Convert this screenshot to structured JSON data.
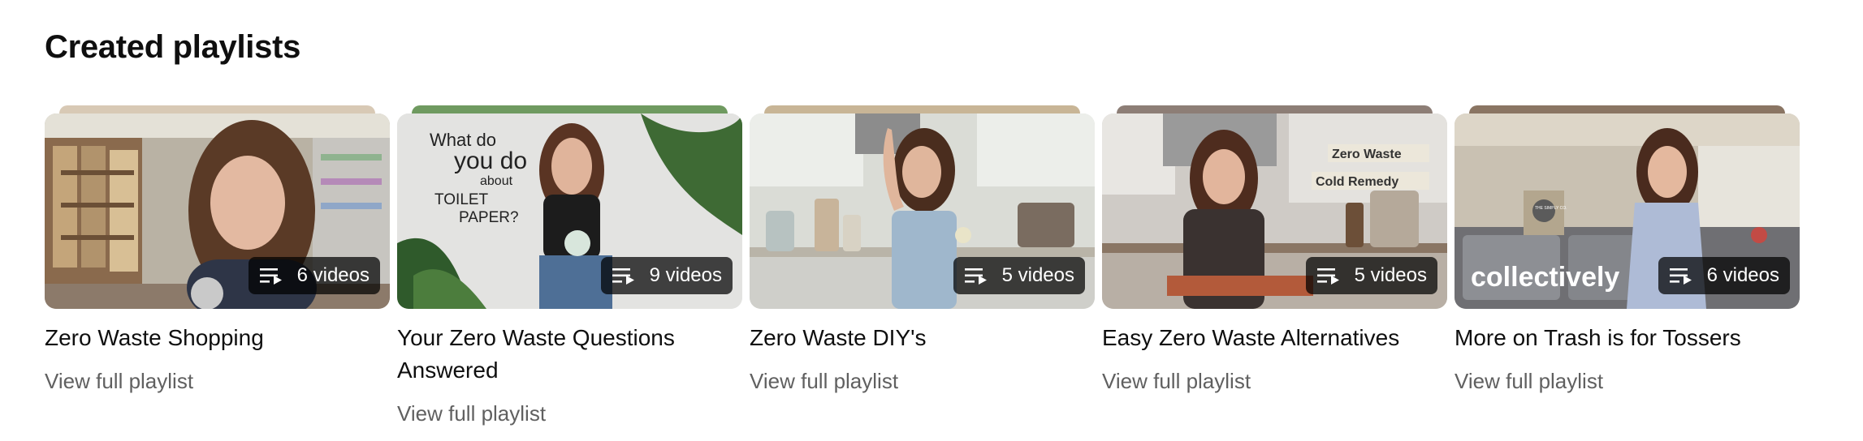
{
  "section": {
    "title": "Created playlists"
  },
  "playlists": [
    {
      "title": "Zero Waste Shopping",
      "count": "6 videos",
      "link": "View full playlist",
      "stack_color": "#d8c9b5"
    },
    {
      "title": "Your Zero Waste Questions Answered",
      "count": "9 videos",
      "link": "View full playlist",
      "stack_color": "#6f9a60",
      "thumb_text": [
        "What do",
        "you do",
        "about",
        "TOILET",
        "PAPER?"
      ]
    },
    {
      "title": "Zero Waste DIY's",
      "count": "5 videos",
      "link": "View full playlist",
      "stack_color": "#c8b596"
    },
    {
      "title": "Easy Zero Waste Alternatives",
      "count": "5 videos",
      "link": "View full playlist",
      "stack_color": "#8d7e76",
      "thumb_text": [
        "Zero Waste",
        "Cold Remedy"
      ]
    },
    {
      "title": "More on Trash is for Tossers",
      "count": "6 videos",
      "link": "View full playlist",
      "stack_color": "#8a7563",
      "thumb_text": [
        "collectively",
        "THE SIMPLY CO."
      ]
    }
  ],
  "icons": {
    "playlist": "playlist-play-icon"
  }
}
